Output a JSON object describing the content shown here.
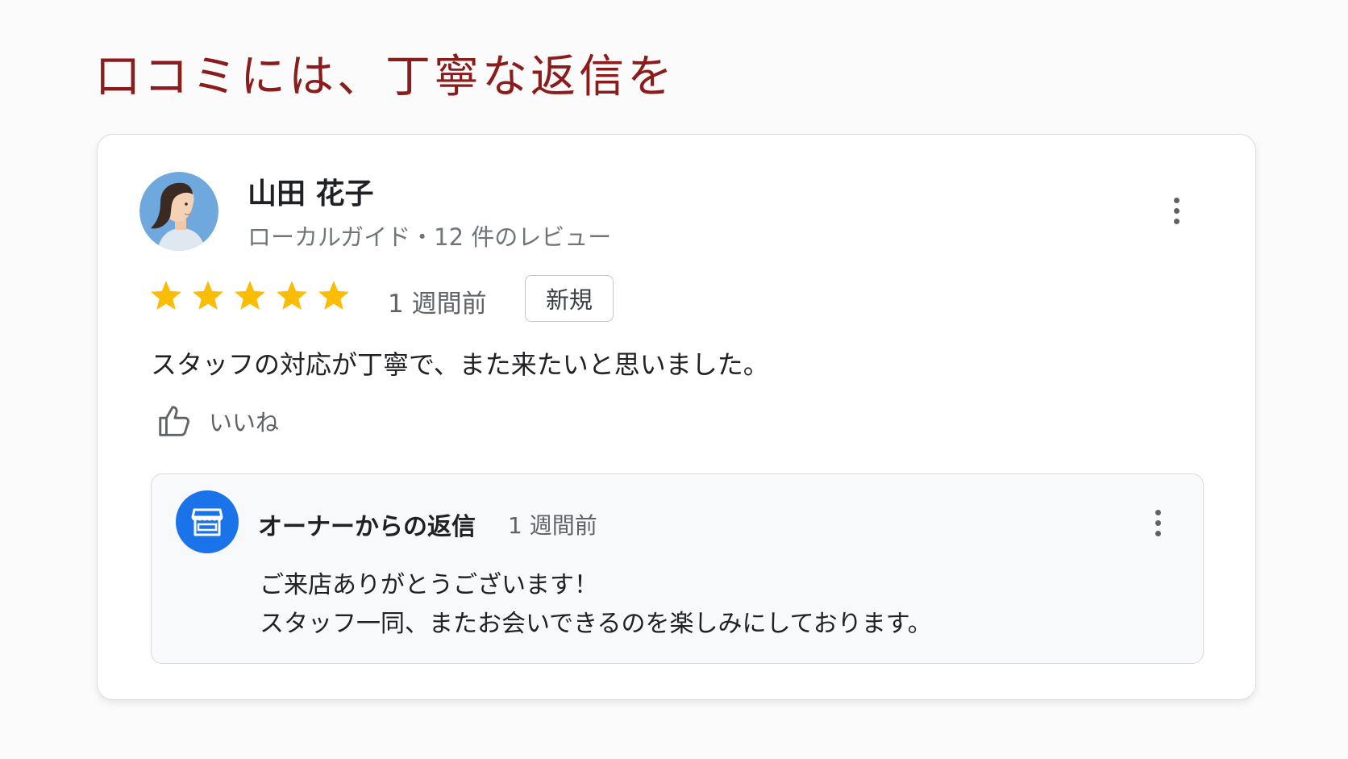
{
  "slide": {
    "title": "口コミには、丁寧な返信を"
  },
  "review": {
    "reviewer_name": "山田 花子",
    "reviewer_meta": "ローカルガイド・12 件のレビュー",
    "rating": 5,
    "rating_max": 5,
    "time": "1 週間前",
    "badge": "新規",
    "text": "スタッフの対応が丁寧で、また来たいと思いました。",
    "like_label": "いいね",
    "more_icon": "more-vert-icon"
  },
  "owner_reply": {
    "title": "オーナーからの返信",
    "time": "1 週間前",
    "lines": [
      "ご来店ありがとうございます！",
      "スタッフ一同、またお会いできるのを楽しみにしております。"
    ],
    "icon": "storefront-icon"
  },
  "colors": {
    "title": "#8b1c1c",
    "star": "#fbbc04",
    "owner_avatar_bg": "#1a73e8",
    "reviewer_avatar_bg": "#6fa8dc"
  }
}
